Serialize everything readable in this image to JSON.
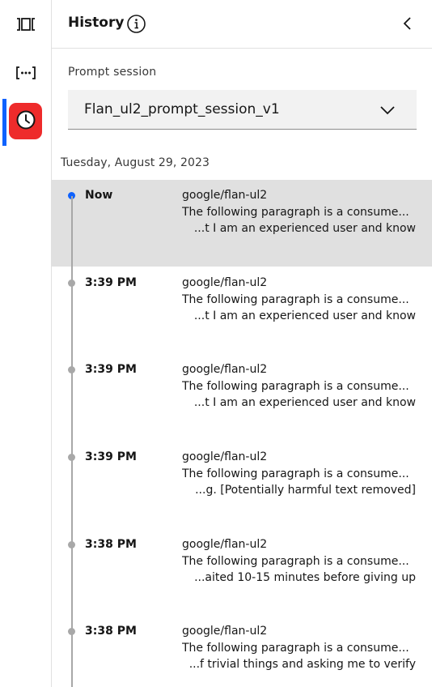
{
  "header": {
    "title": "History"
  },
  "session": {
    "label": "Prompt session",
    "value": "Flan_ul2_prompt_session_v1"
  },
  "history": {
    "date": "Tuesday, August 29, 2023",
    "entries": [
      {
        "time": "Now",
        "model": "google/flan-ul2",
        "line1": "The following paragraph is a consume...",
        "line2": "...t I am an experienced user and know",
        "current": true
      },
      {
        "time": "3:39 PM",
        "model": "google/flan-ul2",
        "line1": "The following paragraph is a consume...",
        "line2": "...t I am an experienced user and know",
        "current": false
      },
      {
        "time": "3:39 PM",
        "model": "google/flan-ul2",
        "line1": "The following paragraph is a consume...",
        "line2": "...t I am an experienced user and know",
        "current": false
      },
      {
        "time": "3:39 PM",
        "model": "google/flan-ul2",
        "line1": "The following paragraph is a consume...",
        "line2": "...g. [Potentially harmful text removed]",
        "current": false
      },
      {
        "time": "3:38 PM",
        "model": "google/flan-ul2",
        "line1": "The following paragraph is a consume...",
        "line2": "...aited 10-15 minutes before giving up",
        "current": false
      },
      {
        "time": "3:38 PM",
        "model": "google/flan-ul2",
        "line1": "The following paragraph is a consume...",
        "line2": "...f trivial things and asking me to verify",
        "current": false
      }
    ]
  },
  "colors": {
    "accent": "#0f62fe",
    "highlight": "#ee2b2b",
    "selected_row": "#e0e0e0"
  },
  "icons": {
    "rail": [
      "compare-icon",
      "code-brackets-icon",
      "history-clock-icon"
    ],
    "header": [
      "information-icon",
      "chevron-left-icon"
    ],
    "select": "chevron-down-icon"
  }
}
